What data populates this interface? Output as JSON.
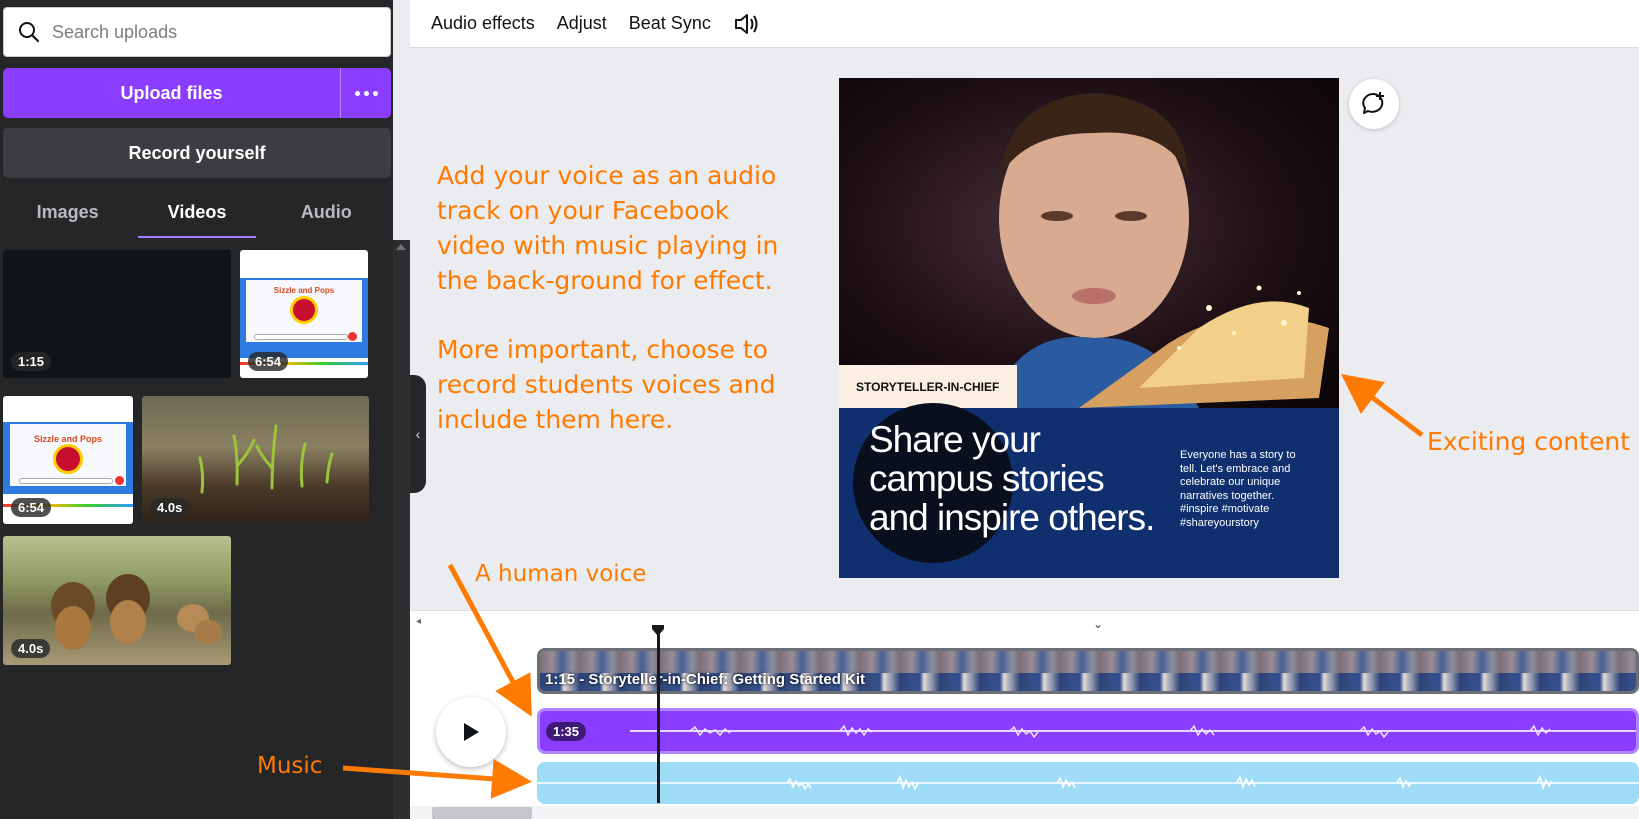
{
  "sidebar": {
    "search_placeholder": "Search uploads",
    "upload_label": "Upload files",
    "record_label": "Record yourself",
    "tabs": [
      {
        "label": "Images"
      },
      {
        "label": "Videos"
      },
      {
        "label": "Audio"
      }
    ],
    "thumbnails": [
      {
        "duration": "1:15"
      },
      {
        "duration": "6:54",
        "title": "Sizzle and Pops"
      },
      {
        "duration": "6:54",
        "title": "Sizzle and Pops"
      },
      {
        "duration": "4.0s"
      },
      {
        "duration": "4.0s"
      }
    ]
  },
  "toolbar": {
    "items": [
      "Audio effects",
      "Adjust",
      "Beat Sync"
    ]
  },
  "annotations": {
    "paragraph1": "Add your voice as an audio track on your Facebook video with music playing in the back-ground for effect.",
    "paragraph2": "More important, choose to record students voices and include them here.",
    "exciting": "Exciting content",
    "human_voice": "A human voice",
    "music": "Music"
  },
  "card": {
    "tag": "STORYTELLER-IN-CHIEF",
    "headline_lines": [
      "Share your",
      "campus stories",
      "and inspire others."
    ],
    "body": "Everyone has a story to tell. Let's embrace and celebrate our unique narratives together. #inspire #motivate #shareyourstory"
  },
  "timeline": {
    "video_label": "1:15 - Storyteller-in-Chief: Getting Started Kit",
    "voice_duration": "1:35"
  },
  "colors": {
    "accent": "#8b3dff",
    "annotation": "#ff7a00",
    "card_blue": "#0f2f6e",
    "music_track": "#9fdcf7"
  }
}
